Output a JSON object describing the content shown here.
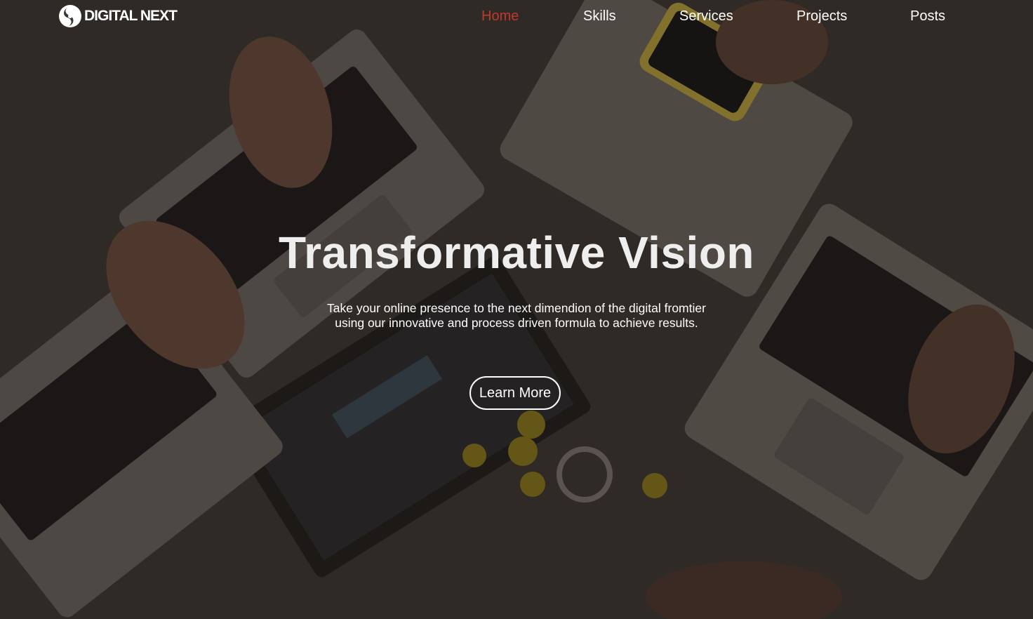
{
  "brand": {
    "logo_text": "DIGITAL NEXT",
    "logo_icon": "swirl-logo-icon"
  },
  "nav": {
    "items": [
      {
        "label": "Home",
        "active": true
      },
      {
        "label": "Skills",
        "active": false
      },
      {
        "label": "Services",
        "active": false
      },
      {
        "label": "Projects",
        "active": false
      },
      {
        "label": "Posts",
        "active": false
      }
    ],
    "active_color": "#c0392b",
    "text_color": "#ffffff"
  },
  "hero": {
    "title": "Transformative Vision",
    "subtitle_line1": "Take your online presence to the next dimendion of the digital fromtier",
    "subtitle_line2": "using our innovative and process driven formula to achieve results.",
    "cta_label": "Learn More",
    "background": "overhead photo of people working on laptops at a tiled table"
  }
}
